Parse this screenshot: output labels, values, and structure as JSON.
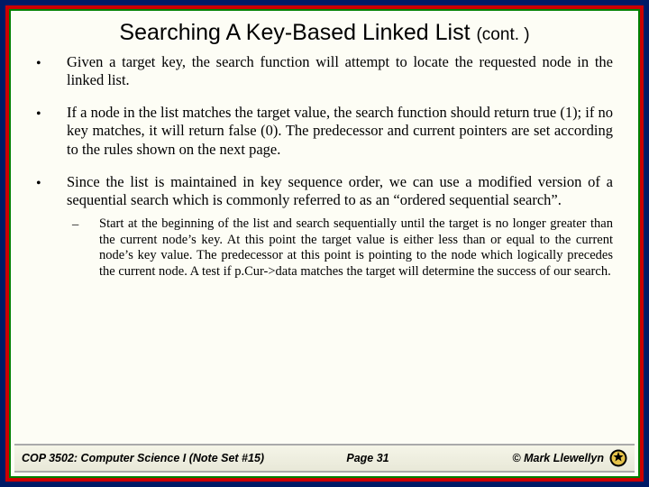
{
  "title_main": "Searching A Key-Based Linked List",
  "title_cont": "(cont. )",
  "bullets": [
    "Given a target key, the search function will attempt to locate the requested node in the linked list.",
    "If a node in the list matches the target value, the search function should return true (1); if no key matches, it will return false (0). The predecessor and current pointers are set according to the rules shown on the next page.",
    "Since the list is maintained in key sequence order, we can use a modified version of a sequential search which is commonly referred to as an “ordered sequential search”."
  ],
  "sub_bullet": "Start at the beginning of the list and search sequentially until the target is no longer greater than the current node’s key. At this point the target value is either less than or equal to the current node’s key value. The predecessor at this point is pointing to the node which logically precedes the current node. A test if p.Cur->data matches the target will determine the success of our search.",
  "footer": {
    "left": "COP 3502: Computer Science I  (Note Set #15)",
    "center": "Page 31",
    "right": "© Mark Llewellyn"
  }
}
